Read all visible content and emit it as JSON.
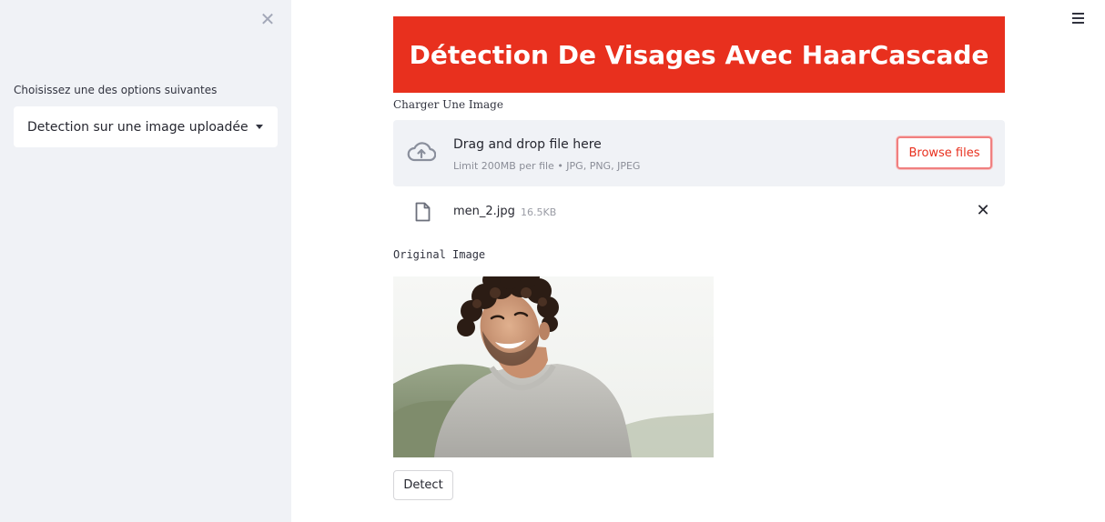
{
  "sidebar": {
    "close_icon": "close-icon",
    "select_label": "Choisissez une des options suivantes",
    "select_value": "Detection sur une image uploadée"
  },
  "header": {
    "menu_icon": "hamburger-menu-icon"
  },
  "main": {
    "banner_title": "Détection De Visages Avec HaarCascade",
    "banner_color": "#e8301e",
    "uploader": {
      "label": "Charger Une Image",
      "dropzone_title": "Drag and drop file here",
      "dropzone_limit": "Limit 200MB per file • JPG, PNG, JPEG",
      "browse_label": "Browse files"
    },
    "file": {
      "name": "men_2.jpg",
      "size": "16.5KB"
    },
    "image_caption": "Original Image",
    "detect_label": "Detect"
  }
}
